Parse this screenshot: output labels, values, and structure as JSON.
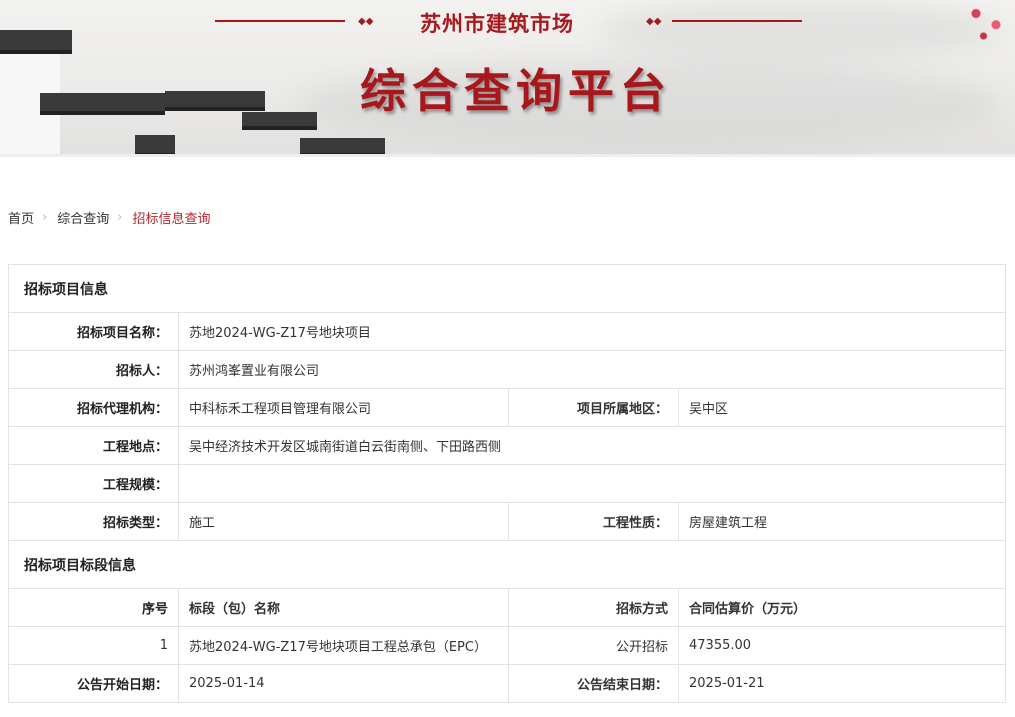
{
  "banner": {
    "subtitle": "苏州市建筑市场",
    "title": "综合查询平台"
  },
  "breadcrumb": [
    "首页",
    "综合查询",
    "招标信息查询"
  ],
  "project": {
    "section_title": "招标项目信息",
    "name_label": "招标项目名称：",
    "name": "苏地2024-WG-Z17号地块项目",
    "tenderer_label": "招标人：",
    "tenderer": "苏州鸿峯置业有限公司",
    "agency_label": "招标代理机构：",
    "agency": "中科标禾工程项目管理有限公司",
    "region_label": "项目所属地区：",
    "region": "吴中区",
    "location_label": "工程地点：",
    "location": "吴中经济技术开发区城南街道白云街南侧、下田路西侧",
    "scale_label": "工程规模：",
    "scale": "",
    "type_label": "招标类型：",
    "type": "施工",
    "nature_label": "工程性质：",
    "nature": "房屋建筑工程"
  },
  "sections": {
    "section_title": "招标项目标段信息",
    "headers": [
      "序号",
      "标段（包）名称",
      "招标方式",
      "合同估算价（万元）"
    ],
    "rows": [
      {
        "no": "1",
        "name": "苏地2024-WG-Z17号地块项目工程总承包（EPC）",
        "method": "公开招标",
        "price": "47355.00"
      }
    ],
    "start_label": "公告开始日期：",
    "start": "2025-01-14",
    "end_label": "公告结束日期：",
    "end": "2025-01-21"
  }
}
